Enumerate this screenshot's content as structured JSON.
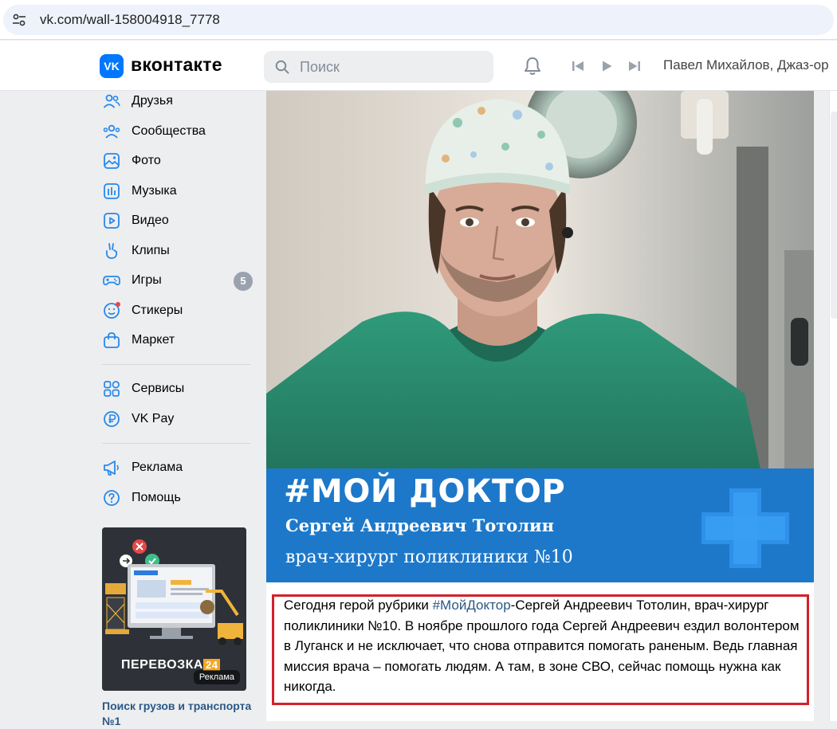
{
  "browser": {
    "url": "vk.com/wall-158004918_7778"
  },
  "header": {
    "logo_text": "VK",
    "brand": "вконтакте",
    "search_placeholder": "Поиск",
    "now_playing": "Павел Михайлов, Джаз-ор"
  },
  "sidebar": {
    "items": [
      {
        "label": "Друзья",
        "icon": "friends-icon"
      },
      {
        "label": "Сообщества",
        "icon": "communities-icon"
      },
      {
        "label": "Фото",
        "icon": "photo-icon"
      },
      {
        "label": "Музыка",
        "icon": "music-icon"
      },
      {
        "label": "Видео",
        "icon": "video-icon"
      },
      {
        "label": "Клипы",
        "icon": "clips-icon"
      },
      {
        "label": "Игры",
        "icon": "games-icon",
        "badge": "5"
      },
      {
        "label": "Стикеры",
        "icon": "stickers-icon"
      },
      {
        "label": "Маркет",
        "icon": "market-icon"
      },
      {
        "label": "Сервисы",
        "icon": "services-icon"
      },
      {
        "label": "VK Pay",
        "icon": "vkpay-icon"
      },
      {
        "label": "Реклама",
        "icon": "ads-icon"
      },
      {
        "label": "Помощь",
        "icon": "help-icon"
      }
    ],
    "ad": {
      "brand": "ПЕРЕВОЗКА",
      "brand_num": "24",
      "badge": "Реклама",
      "title": "Поиск грузов и транспорта №1"
    }
  },
  "post": {
    "banner_tag": "#МОЙ ДОКТОР",
    "banner_name": "Сергей Андреевич Тотолин",
    "banner_role": "врач-хирург поликлиники №10",
    "text_prefix": "Сегодня герой рубрики ",
    "hashtag": "#МойДоктор",
    "text_rest": "-Сергей Андреевич Тотолин, врач-хирург поликлиники №10. В ноябре прошлого года Сергей Андреевич ездил волонтером в Луганск и не исключает, что снова отправится помогать раненым. Ведь главная миссия врача – помогать людям. А там, в зоне СВО, сейчас помощь нужна как никогда."
  },
  "colors": {
    "vk_blue": "#0077ff",
    "banner_blue": "#1d78c9",
    "link": "#2a5885",
    "highlight_border": "#d4202a"
  }
}
